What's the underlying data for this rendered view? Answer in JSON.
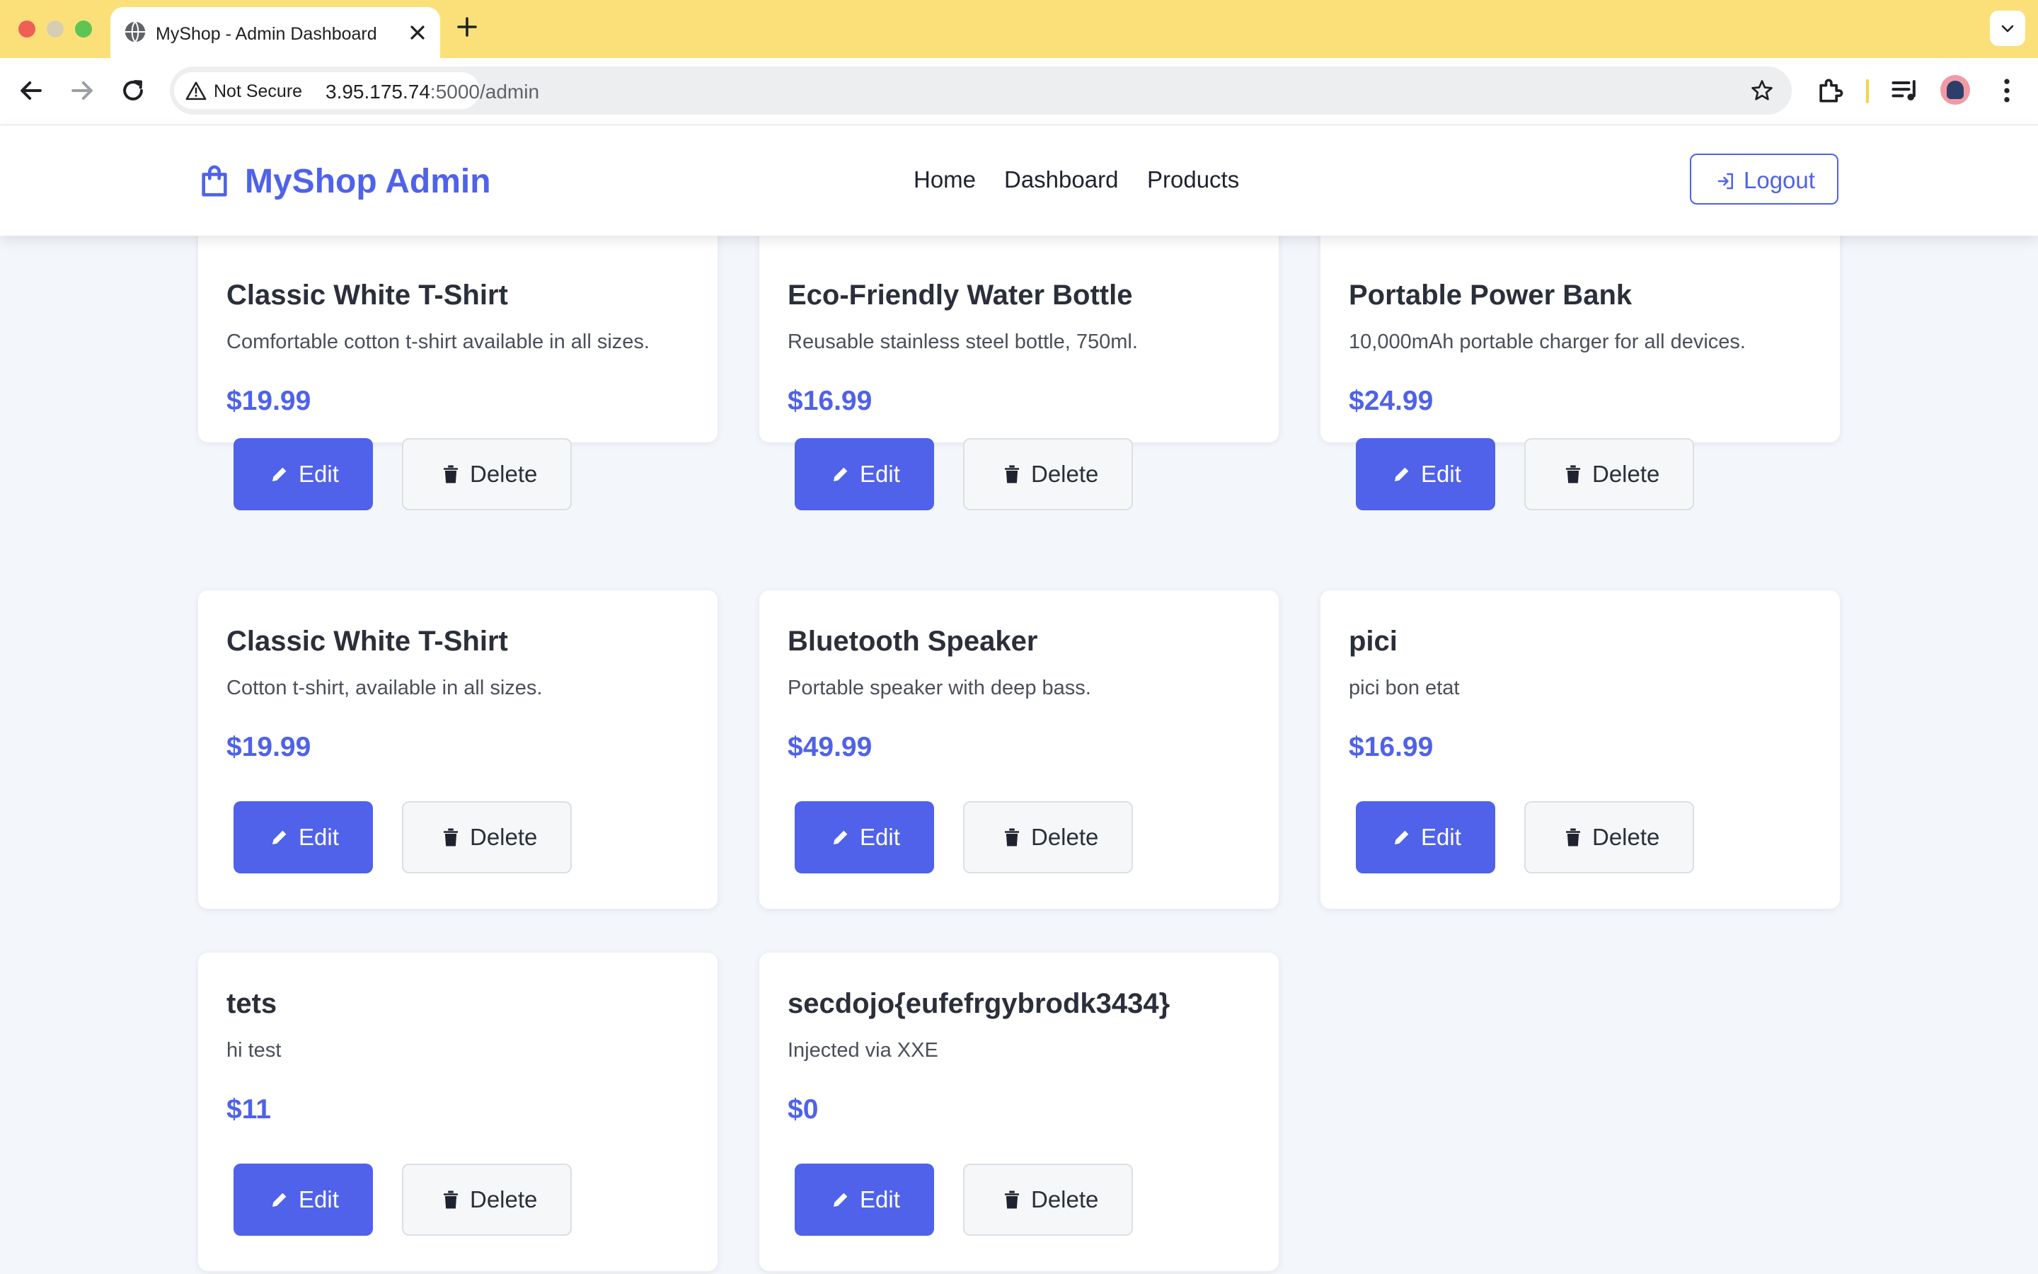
{
  "browser": {
    "tab_title": "MyShop - Admin Dashboard",
    "security_chip": "Not Secure",
    "url_host": "3.95.175.74",
    "url_path": ":5000/admin"
  },
  "header": {
    "brand": "MyShop Admin",
    "nav": [
      "Home",
      "Dashboard",
      "Products"
    ],
    "logout_label": "Logout"
  },
  "product_actions": {
    "edit_label": "Edit",
    "delete_label": "Delete"
  },
  "products": [
    {
      "name": "Classic White T-Shirt",
      "description": "Comfortable cotton t-shirt available in all sizes.",
      "price": "$19.99"
    },
    {
      "name": "Eco-Friendly Water Bottle",
      "description": "Reusable stainless steel bottle, 750ml.",
      "price": "$16.99"
    },
    {
      "name": "Portable Power Bank",
      "description": "10,000mAh portable charger for all devices.",
      "price": "$24.99"
    },
    {
      "name": "Classic White T-Shirt",
      "description": "Cotton t-shirt, available in all sizes.",
      "price": "$19.99"
    },
    {
      "name": "Bluetooth Speaker",
      "description": "Portable speaker with deep bass.",
      "price": "$49.99"
    },
    {
      "name": "pici",
      "description": "pici bon etat",
      "price": "$16.99"
    },
    {
      "name": "tets",
      "description": "hi test",
      "price": "$11"
    },
    {
      "name": "secdojo{eufefrgybrodk3434}",
      "description": "Injected via XXE",
      "price": "$0"
    }
  ],
  "colors": {
    "accent": "#4f62e9",
    "tabbar": "#fbe07a",
    "page_bg": "#f3f6fb"
  },
  "icons": [
    "globe-icon",
    "close-icon",
    "plus-icon",
    "back-icon",
    "forward-icon",
    "reload-icon",
    "warning-icon",
    "star-icon",
    "extensions-icon",
    "media-icon",
    "menu-icon",
    "shopping-bag-icon",
    "logout-icon",
    "pencil-icon",
    "trash-icon"
  ]
}
